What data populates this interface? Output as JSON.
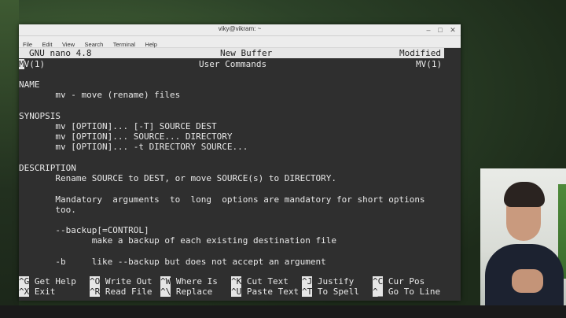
{
  "window": {
    "title": "viky@vikram: ~",
    "minimize": "–",
    "maximize": "□",
    "close": "✕"
  },
  "menu": [
    "File",
    "Edit",
    "View",
    "Search",
    "Terminal",
    "Help"
  ],
  "nano_header": {
    "version": "GNU nano 4.8",
    "buffer": "New Buffer",
    "state": "Modified"
  },
  "content": {
    "man_left": "MV(1)",
    "man_center": "User Commands",
    "man_right": "MV(1)",
    "name_heading": "NAME",
    "name_text": "       mv - move (rename) files",
    "synopsis_heading": "SYNOPSIS",
    "synopsis_1": "       mv [OPTION]... [-T] SOURCE DEST",
    "synopsis_2": "       mv [OPTION]... SOURCE... DIRECTORY",
    "synopsis_3": "       mv [OPTION]... -t DIRECTORY SOURCE...",
    "desc_heading": "DESCRIPTION",
    "desc_1": "       Rename SOURCE to DEST, or move SOURCE(s) to DIRECTORY.",
    "desc_2": "       Mandatory  arguments  to  long  options are mandatory for short options",
    "desc_3": "       too.",
    "opt_backup": "       --backup[=CONTROL]",
    "opt_backup_desc": "              make a backup of each existing destination file",
    "opt_b": "       -b     like --backup but does not accept an argument"
  },
  "shortcuts": {
    "row1": [
      {
        "key": "^G",
        "label": " Get Help"
      },
      {
        "key": "^O",
        "label": " Write Out"
      },
      {
        "key": "^W",
        "label": " Where Is"
      },
      {
        "key": "^K",
        "label": " Cut Text"
      },
      {
        "key": "^J",
        "label": " Justify"
      },
      {
        "key": "^C",
        "label": " Cur Pos"
      }
    ],
    "row2": [
      {
        "key": "^X",
        "label": " Exit"
      },
      {
        "key": "^R",
        "label": " Read File"
      },
      {
        "key": "^\\",
        "label": " Replace"
      },
      {
        "key": "^U",
        "label": " Paste Text"
      },
      {
        "key": "^T",
        "label": " To Spell"
      },
      {
        "key": "^_",
        "label": " Go To Line"
      }
    ]
  }
}
